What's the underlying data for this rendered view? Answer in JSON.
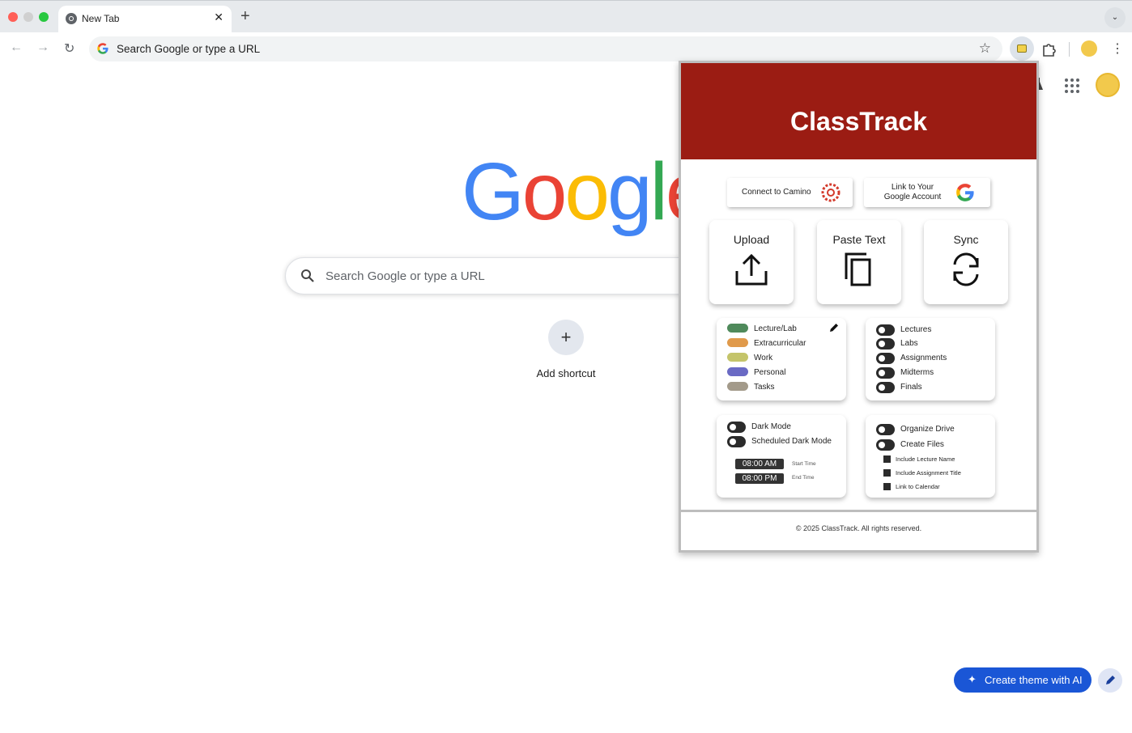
{
  "browser": {
    "tab": {
      "title": "New Tab",
      "close": "✕"
    },
    "new_tab_symbol": "+",
    "tab_menu_symbol": "⌄",
    "omnibox": {
      "text": "Search Google or type a URL"
    },
    "nav": {
      "back": "←",
      "forward": "→",
      "reload": "↻"
    },
    "star_symbol": "☆",
    "kebab_symbol": "⋮"
  },
  "ntp": {
    "logo": [
      "G",
      "o",
      "o",
      "g",
      "l",
      "e"
    ],
    "logo_colors": [
      "#4285f4",
      "#ea4335",
      "#fbbc05",
      "#4285f4",
      "#34a853",
      "#ea4335"
    ],
    "search_placeholder": "Search Google or type a URL",
    "shortcut": {
      "symbol": "+",
      "label": "Add shortcut"
    },
    "ai_button": {
      "symbol": "✦",
      "label": "Create theme with AI"
    }
  },
  "classtrack": {
    "title": "ClassTrack",
    "brand_color": "#9b1c13",
    "connect_camino": "Connect to Camino",
    "link_google": [
      "Link to Your",
      "Google Account"
    ],
    "actions": [
      {
        "label": "Upload",
        "icon": "upload-icon"
      },
      {
        "label": "Paste Text",
        "icon": "copy-icon"
      },
      {
        "label": "Sync",
        "icon": "sync-icon"
      }
    ],
    "categories": [
      {
        "label": "Lecture/Lab",
        "color": "#4f8a5b"
      },
      {
        "label": "Extracurricular",
        "color": "#e09a4b"
      },
      {
        "label": "Work",
        "color": "#c4c46a"
      },
      {
        "label": "Personal",
        "color": "#6a6ac4"
      },
      {
        "label": "Tasks",
        "color": "#a39a8a"
      }
    ],
    "filters": [
      "Lectures",
      "Labs",
      "Assignments",
      "Midterms",
      "Finals"
    ],
    "dark_mode": {
      "label": "Dark Mode",
      "scheduled_label": "Scheduled Dark Mode",
      "start_time": "08:00 AM",
      "start_label": "Start Time",
      "end_time": "08:00 PM",
      "end_label": "End Time"
    },
    "drive": {
      "organize_label": "Organize Drive",
      "create_label": "Create Files",
      "options": [
        "Include Lecture Name",
        "Include Assignment Title",
        "Link to Calendar"
      ]
    },
    "footer": "© 2025 ClassTrack. All rights reserved."
  }
}
